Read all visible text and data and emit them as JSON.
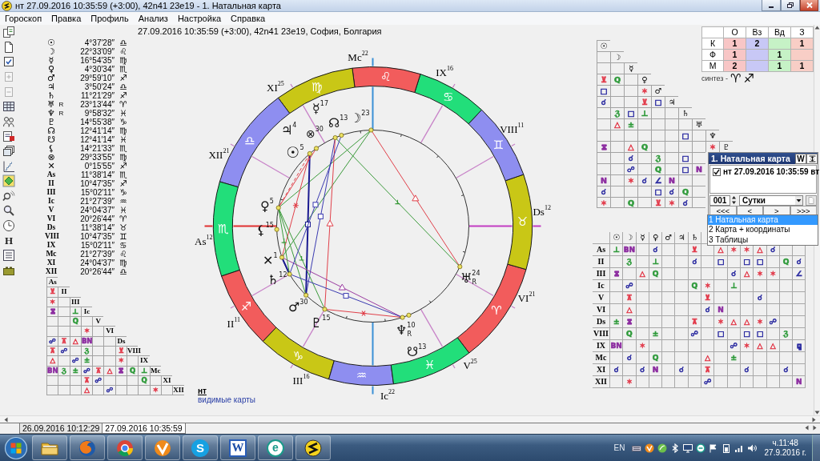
{
  "window": {
    "title": "нт 27.09.2016 10:35:59 (+3:00), 42n41 23e19 - 1. Натальная карта"
  },
  "menu": [
    "Гороскоп",
    "Правка",
    "Профиль",
    "Анализ",
    "Настройка",
    "Справка"
  ],
  "toolbar": [
    {
      "kind": "documents",
      "disabled": false
    },
    {
      "kind": "new-document",
      "disabled": false
    },
    {
      "kind": "checked-document",
      "disabled": false
    },
    {
      "kind": "add-document",
      "disabled": true
    },
    {
      "kind": "remove-document",
      "disabled": true
    },
    {
      "kind": "grid",
      "disabled": false
    },
    {
      "kind": "people",
      "disabled": false
    },
    {
      "kind": "flagged-document",
      "disabled": false
    },
    {
      "kind": "windows",
      "disabled": false
    },
    {
      "kind": "chart",
      "disabled": false
    },
    {
      "kind": "diamond",
      "disabled": false
    },
    {
      "kind": "signal-search",
      "disabled": false
    },
    {
      "kind": "search",
      "disabled": false
    },
    {
      "kind": "clock",
      "disabled": false
    },
    {
      "kind": "letter",
      "label": "H",
      "disabled": false
    },
    {
      "kind": "list",
      "disabled": false
    },
    {
      "kind": "battery",
      "disabled": false
    }
  ],
  "chart_header": "27.09.2016 10:35:59 (+3:00), 42n41 23e19, София, Болгария",
  "positions": [
    {
      "kind": "planet",
      "point": "☉",
      "value": "4°37′28″",
      "sign": "♎"
    },
    {
      "kind": "planet",
      "point": "☽",
      "value": "22°33′09″",
      "sign": "♌"
    },
    {
      "kind": "planet",
      "point": "☿",
      "value": "16°54′35″",
      "sign": "♍"
    },
    {
      "kind": "planet",
      "point": "♀",
      "value": "4°30′34″",
      "sign": "♏"
    },
    {
      "kind": "planet",
      "point": "♂",
      "value": "29°59′10″",
      "sign": "♐"
    },
    {
      "kind": "planet",
      "point": "♃",
      "value": "3°50′24″",
      "sign": "♎"
    },
    {
      "kind": "planet",
      "point": "♄",
      "value": "11°21′29″",
      "sign": "♐"
    },
    {
      "kind": "planet",
      "point": "♅",
      "retro": "R",
      "value": "23°13′44″",
      "sign": "♈"
    },
    {
      "kind": "planet",
      "point": "♆",
      "retro": "R",
      "value": "9°58′32″",
      "sign": "♓"
    },
    {
      "kind": "planet",
      "point": "♇",
      "value": "14°55′38″",
      "sign": "♑"
    },
    {
      "kind": "planet",
      "point": "☊",
      "value": "12°41′14″",
      "sign": "♍"
    },
    {
      "kind": "planet",
      "point": "☋",
      "value": "12°41′14″",
      "sign": "♓"
    },
    {
      "kind": "planet",
      "point": "⚸",
      "value": "14°21′33″",
      "sign": "♏"
    },
    {
      "kind": "planet",
      "point": "⊗",
      "value": "29°33′55″",
      "sign": "♍"
    },
    {
      "kind": "planet",
      "point": "✕",
      "value": "0°15′55″",
      "sign": "♐"
    },
    {
      "kind": "cusp",
      "point": "As",
      "value": "11°38′14″",
      "sign": "♏"
    },
    {
      "kind": "cusp",
      "point": "II",
      "value": "10°47′35″",
      "sign": "♐"
    },
    {
      "kind": "cusp",
      "point": "III",
      "value": "15°02′11″",
      "sign": "♑"
    },
    {
      "kind": "cusp",
      "point": "Ic",
      "value": "21°27′39″",
      "sign": "♒"
    },
    {
      "kind": "cusp",
      "point": "V",
      "value": "24°04′37″",
      "sign": "♓"
    },
    {
      "kind": "cusp",
      "point": "VI",
      "value": "20°26′44″",
      "sign": "♈"
    },
    {
      "kind": "cusp",
      "point": "Ds",
      "value": "11°38′14″",
      "sign": "♉"
    },
    {
      "kind": "cusp",
      "point": "VIII",
      "value": "10°47′35″",
      "sign": "♊"
    },
    {
      "kind": "cusp",
      "point": "IX",
      "value": "15°02′11″",
      "sign": "♋"
    },
    {
      "kind": "cusp",
      "point": "Mc",
      "value": "21°27′39″",
      "sign": "♌"
    },
    {
      "kind": "cusp",
      "point": "XI",
      "value": "24°04′37″",
      "sign": "♍"
    },
    {
      "kind": "cusp",
      "point": "XII",
      "value": "20°26′44″",
      "sign": "♎"
    }
  ],
  "house_aspects": {
    "rows": [
      {
        "label": "As"
      },
      {
        "label": "II",
        "cells": [
          {
            "symbol": "⊻",
            "color": "#e23a4a"
          }
        ]
      },
      {
        "label": "III",
        "cells": [
          {
            "symbol": "✶",
            "color": "#e23a4a"
          },
          null
        ]
      },
      {
        "label": "Ic",
        "cells": [
          {
            "symbol": "⧖",
            "color": "#8c2ca0"
          },
          null,
          {
            "symbol": "⊥",
            "color": "#2e9a3a"
          }
        ]
      },
      {
        "label": "V",
        "cells": [
          null,
          null,
          {
            "symbol": "Q",
            "color": "#2e9a3a"
          },
          null
        ]
      },
      {
        "label": "VI",
        "cells": [
          null,
          null,
          null,
          {
            "symbol": "✶",
            "color": "#e23a4a"
          },
          null
        ]
      },
      {
        "label": "Ds",
        "cells": [
          {
            "symbol": "☍",
            "color": "#2a2aa0"
          },
          {
            "symbol": "⊼",
            "color": "#e23a4a"
          },
          {
            "symbol": "△",
            "color": "#e23a4a"
          },
          {
            "symbol": "BN",
            "color": "#8c2ca0"
          },
          null,
          null
        ]
      },
      {
        "label": "VIII",
        "cells": [
          {
            "symbol": "⊼",
            "color": "#e23a4a"
          },
          {
            "symbol": "☍",
            "color": "#2a2aa0"
          },
          null,
          {
            "symbol": "ℨ",
            "color": "#2e9a3a"
          },
          null,
          null,
          {
            "symbol": "⊻",
            "color": "#e23a4a"
          }
        ]
      },
      {
        "label": "IX",
        "cells": [
          {
            "symbol": "△",
            "color": "#e23a4a"
          },
          null,
          {
            "symbol": "☍",
            "color": "#2a2aa0"
          },
          {
            "symbol": "±",
            "color": "#2e9a3a"
          },
          null,
          null,
          {
            "symbol": "✶",
            "color": "#e23a4a"
          },
          null
        ]
      },
      {
        "label": "Mc",
        "cells": [
          {
            "symbol": "BN",
            "color": "#8c2ca0"
          },
          {
            "symbol": "ℨ",
            "color": "#2e9a3a"
          },
          {
            "symbol": "±",
            "color": "#2e9a3a"
          },
          {
            "symbol": "☍",
            "color": "#2a2aa0"
          },
          {
            "symbol": "⊼",
            "color": "#e23a4a"
          },
          {
            "symbol": "△",
            "color": "#e23a4a"
          },
          {
            "symbol": "⧖",
            "color": "#8c2ca0"
          },
          {
            "symbol": "Q",
            "color": "#2e9a3a"
          },
          {
            "symbol": "⊥",
            "color": "#2e9a3a"
          }
        ]
      },
      {
        "label": "XI",
        "cells": [
          null,
          null,
          null,
          {
            "symbol": "⊼",
            "color": "#e23a4a"
          },
          {
            "symbol": "☍",
            "color": "#2a2aa0"
          },
          null,
          null,
          null,
          {
            "symbol": "Q",
            "color": "#2e9a3a"
          },
          null
        ]
      },
      {
        "label": "XII",
        "cells": [
          null,
          null,
          null,
          {
            "symbol": "△",
            "color": "#e23a4a"
          },
          null,
          {
            "symbol": "☍",
            "color": "#2a2aa0"
          },
          null,
          null,
          null,
          {
            "symbol": "✶",
            "color": "#e23a4a"
          },
          null
        ]
      }
    ]
  },
  "wheel": {
    "signs": [
      {
        "glyph": "♈",
        "color": "#f25c5c"
      },
      {
        "glyph": "♉",
        "color": "#c9c716"
      },
      {
        "glyph": "♊",
        "color": "#8e8ef0"
      },
      {
        "glyph": "♋",
        "color": "#22de7a"
      },
      {
        "glyph": "♌",
        "color": "#f25c5c"
      },
      {
        "glyph": "♍",
        "color": "#c9c716"
      },
      {
        "glyph": "♎",
        "color": "#8e8ef0"
      },
      {
        "glyph": "♏",
        "color": "#22de7a"
      },
      {
        "glyph": "♐",
        "color": "#f25c5c"
      },
      {
        "glyph": "♑",
        "color": "#c9c716"
      },
      {
        "glyph": "♒",
        "color": "#8e8ef0"
      },
      {
        "glyph": "♓",
        "color": "#22de7a"
      }
    ],
    "houses": [
      {
        "label": "As",
        "degree": "12",
        "color": "#e03030"
      },
      {
        "label": "II",
        "degree": "11",
        "color": "#c883c8"
      },
      {
        "label": "III",
        "degree": "16",
        "color": "#c883c8"
      },
      {
        "label": "Ic",
        "degree": "22",
        "color": "#3a90d6"
      },
      {
        "label": "V",
        "degree": "25",
        "color": "#c883c8"
      },
      {
        "label": "VI",
        "degree": "21",
        "color": "#c883c8"
      },
      {
        "label": "Ds",
        "degree": "12",
        "color": "#c23cc2"
      },
      {
        "label": "VIII",
        "degree": "11",
        "color": "#c883c8"
      },
      {
        "label": "IX",
        "degree": "16",
        "color": "#c883c8"
      },
      {
        "label": "Mc",
        "degree": "22",
        "color": "#3a90d6"
      },
      {
        "label": "XI",
        "degree": "25",
        "color": "#c883c8"
      },
      {
        "label": "XII",
        "degree": "21",
        "color": "#c883c8"
      }
    ],
    "planets": [
      {
        "glyph": "☉",
        "degree": "5"
      },
      {
        "glyph": "☽",
        "degree": "23"
      },
      {
        "glyph": "☿",
        "degree": "17"
      },
      {
        "glyph": "♀",
        "degree": "5"
      },
      {
        "glyph": "♂",
        "degree": "30"
      },
      {
        "glyph": "♃",
        "degree": "4"
      },
      {
        "glyph": "♄",
        "degree": "12"
      },
      {
        "glyph": "♅",
        "degree": "24",
        "retro": "R"
      },
      {
        "glyph": "♆",
        "degree": "10",
        "retro": "R"
      },
      {
        "glyph": "♇",
        "degree": "15"
      },
      {
        "glyph": "☊",
        "degree": "13"
      },
      {
        "glyph": "☋",
        "degree": "13"
      },
      {
        "glyph": "⚸",
        "degree": "15"
      },
      {
        "glyph": "⊗",
        "degree": "30"
      },
      {
        "glyph": "✕",
        "degree": "1"
      }
    ]
  },
  "caption": {
    "title": "нт",
    "link": "видимые карты"
  },
  "elements_table": {
    "columns": [
      {
        "label": "О",
        "color": "#f8c6c6"
      },
      {
        "label": "Вз",
        "color": "#c8c8f6"
      },
      {
        "label": "Вд",
        "color": "#c6f2c6"
      },
      {
        "label": "З",
        "color": "#f8cec6"
      }
    ],
    "rows": [
      {
        "label": "К",
        "cells": [
          "1",
          "2",
          null,
          "1"
        ]
      },
      {
        "label": "Ф",
        "cells": [
          "1",
          null,
          "1",
          null
        ]
      },
      {
        "label": "М",
        "cells": [
          "2",
          null,
          "1",
          "1"
        ]
      }
    ]
  },
  "synthesis": {
    "label": "синтез -",
    "signs": [
      "♈",
      "♐"
    ]
  },
  "planet_aspects": {
    "rows": [
      {
        "label": "☉"
      },
      {
        "label": "☽",
        "cells": [
          null
        ]
      },
      {
        "label": "☿",
        "cells": [
          null,
          null
        ]
      },
      {
        "label": "♀",
        "cells": [
          {
            "symbol": "⊻",
            "color": "#e23a4a"
          },
          {
            "symbol": "Q",
            "color": "#2e9a3a"
          },
          null
        ]
      },
      {
        "label": "♂",
        "cells": [
          {
            "symbol": "□",
            "color": "#2a2aa0"
          },
          null,
          null,
          {
            "symbol": "✶",
            "color": "#e23a4a"
          }
        ]
      },
      {
        "label": "♃",
        "cells": [
          {
            "symbol": "☌",
            "color": "#2a2aa0"
          },
          null,
          null,
          {
            "symbol": "⊻",
            "color": "#e23a4a"
          },
          {
            "symbol": "□",
            "color": "#2a2aa0"
          }
        ]
      },
      {
        "label": "♄",
        "cells": [
          null,
          {
            "symbol": "ℨ",
            "color": "#2e9a3a"
          },
          {
            "symbol": "□",
            "color": "#2a2aa0"
          },
          {
            "symbol": "⊥",
            "color": "#2e9a3a"
          },
          null,
          null
        ]
      },
      {
        "label": "♅",
        "cells": [
          null,
          {
            "symbol": "△",
            "color": "#e23a4a"
          },
          {
            "symbol": "±",
            "color": "#2e9a3a"
          },
          null,
          null,
          null,
          null
        ]
      },
      {
        "label": "♆",
        "cells": [
          null,
          null,
          null,
          null,
          null,
          null,
          {
            "symbol": "□",
            "color": "#2a2aa0"
          },
          null
        ]
      },
      {
        "label": "♇",
        "cells": [
          {
            "symbol": "⧖",
            "color": "#8c2ca0"
          },
          null,
          {
            "symbol": "△",
            "color": "#e23a4a"
          },
          {
            "symbol": "Q",
            "color": "#2e9a3a"
          },
          null,
          null,
          null,
          null,
          {
            "symbol": "✶",
            "color": "#e23a4a"
          }
        ]
      },
      {
        "cells": [
          null,
          null,
          {
            "symbol": "☌",
            "color": "#2a2aa0"
          },
          null,
          {
            "symbol": "ℨ",
            "color": "#2e9a3a"
          },
          null,
          {
            "symbol": "□",
            "color": "#2a2aa0"
          },
          null
        ]
      },
      {
        "cells": [
          null,
          null,
          {
            "symbol": "☍",
            "color": "#2a2aa0"
          },
          null,
          {
            "symbol": "Q",
            "color": "#2e9a3a"
          },
          null,
          {
            "symbol": "□",
            "color": "#2a2aa0"
          },
          {
            "symbol": "N",
            "color": "#8c2ca0"
          }
        ]
      },
      {
        "cells": [
          {
            "symbol": "N",
            "color": "#8c2ca0"
          },
          null,
          {
            "symbol": "✶",
            "color": "#e23a4a"
          },
          {
            "symbol": "☌",
            "color": "#2a2aa0"
          },
          {
            "symbol": "∠",
            "color": "#2a2aa0"
          },
          {
            "symbol": "N",
            "color": "#8c2ca0"
          },
          null,
          null
        ]
      },
      {
        "cells": [
          {
            "symbol": "☌",
            "color": "#2a2aa0"
          },
          null,
          null,
          null,
          {
            "symbol": "□",
            "color": "#2a2aa0"
          },
          {
            "symbol": "☌",
            "color": "#2a2aa0"
          },
          {
            "symbol": "Q",
            "color": "#2e9a3a"
          },
          null
        ]
      },
      {
        "cells": [
          {
            "symbol": "✶",
            "color": "#e23a4a"
          },
          null,
          {
            "symbol": "Q",
            "color": "#2e9a3a"
          },
          null,
          {
            "symbol": "⊻",
            "color": "#e23a4a"
          },
          {
            "symbol": "✶",
            "color": "#e23a4a"
          },
          {
            "symbol": "☌",
            "color": "#2a2aa0"
          },
          null
        ]
      }
    ]
  },
  "house_planet_aspects": {
    "columns": [
      "☉",
      "☽",
      "☿",
      "♀",
      "♂",
      "♃",
      "♄"
    ],
    "rows": [
      {
        "label": "As",
        "cells": [
          {
            "symbol": "⊥",
            "color": "#2e9a3a"
          },
          {
            "symbol": "BN",
            "color": "#8c2ca0"
          },
          null,
          {
            "symbol": "☌",
            "color": "#2a2aa0"
          },
          null,
          null,
          {
            "symbol": "⊻",
            "color": "#e23a4a"
          },
          null,
          {
            "symbol": "△",
            "color": "#e23a4a"
          },
          {
            "symbol": "✶",
            "color": "#e23a4a"
          },
          {
            "symbol": "✶",
            "color": "#e23a4a"
          },
          {
            "symbol": "△",
            "color": "#e23a4a"
          },
          {
            "symbol": "☌",
            "color": "#2a2aa0"
          }
        ]
      },
      {
        "label": "II",
        "cells": [
          null,
          {
            "symbol": "ℨ",
            "color": "#2e9a3a"
          },
          null,
          {
            "symbol": "⊥",
            "color": "#2e9a3a"
          },
          null,
          null,
          {
            "symbol": "☌",
            "color": "#2a2aa0"
          },
          null,
          {
            "symbol": "□",
            "color": "#2a2aa0"
          },
          null,
          {
            "symbol": "□",
            "color": "#2a2aa0"
          },
          {
            "symbol": "□",
            "color": "#2a2aa0"
          },
          null,
          {
            "symbol": "Q",
            "color": "#2e9a3a"
          },
          {
            "symbol": "☌",
            "color": "#2a2aa0"
          }
        ]
      },
      {
        "label": "III",
        "cells": [
          {
            "symbol": "⧖",
            "color": "#8c2ca0"
          },
          null,
          {
            "symbol": "△",
            "color": "#e23a4a"
          },
          {
            "symbol": "Q",
            "color": "#2e9a3a"
          },
          null,
          null,
          null,
          null,
          null,
          {
            "symbol": "☌",
            "color": "#2a2aa0"
          },
          {
            "symbol": "△",
            "color": "#e23a4a"
          },
          {
            "symbol": "✶",
            "color": "#e23a4a"
          },
          {
            "symbol": "✶",
            "color": "#e23a4a"
          },
          null,
          {
            "symbol": "∠",
            "color": "#2a2aa0"
          }
        ]
      },
      {
        "label": "Ic",
        "cells": [
          null,
          {
            "symbol": "☍",
            "color": "#2a2aa0"
          },
          null,
          null,
          null,
          null,
          {
            "symbol": "Q",
            "color": "#2e9a3a"
          },
          {
            "symbol": "✶",
            "color": "#e23a4a"
          },
          null,
          {
            "symbol": "⊥",
            "color": "#2e9a3a"
          }
        ]
      },
      {
        "label": "V",
        "cells": [
          null,
          {
            "symbol": "⊼",
            "color": "#e23a4a"
          },
          null,
          null,
          null,
          null,
          null,
          {
            "symbol": "⊻",
            "color": "#e23a4a"
          },
          null,
          null,
          null,
          {
            "symbol": "☌",
            "color": "#2a2aa0"
          }
        ]
      },
      {
        "label": "VI",
        "cells": [
          null,
          {
            "symbol": "△",
            "color": "#e23a4a"
          },
          null,
          null,
          null,
          null,
          null,
          {
            "symbol": "☌",
            "color": "#2a2aa0"
          },
          {
            "symbol": "N",
            "color": "#8c2ca0"
          }
        ]
      },
      {
        "label": "Ds",
        "cells": [
          {
            "symbol": "±",
            "color": "#2e9a3a"
          },
          {
            "symbol": "⧖",
            "color": "#8c2ca0"
          },
          null,
          null,
          null,
          null,
          {
            "symbol": "⊼",
            "color": "#e23a4a"
          },
          null,
          {
            "symbol": "✶",
            "color": "#e23a4a"
          },
          {
            "symbol": "△",
            "color": "#e23a4a"
          },
          {
            "symbol": "△",
            "color": "#e23a4a"
          },
          {
            "symbol": "✶",
            "color": "#e23a4a"
          },
          {
            "symbol": "☍",
            "color": "#2a2aa0"
          }
        ]
      },
      {
        "label": "VIII",
        "cells": [
          null,
          {
            "symbol": "Q",
            "color": "#2e9a3a"
          },
          null,
          {
            "symbol": "±",
            "color": "#2e9a3a"
          },
          null,
          null,
          {
            "symbol": "☍",
            "color": "#2a2aa0"
          },
          null,
          {
            "symbol": "□",
            "color": "#2a2aa0"
          },
          null,
          {
            "symbol": "□",
            "color": "#2a2aa0"
          },
          {
            "symbol": "□",
            "color": "#2a2aa0"
          },
          null,
          {
            "symbol": "ℨ",
            "color": "#2e9a3a"
          }
        ]
      },
      {
        "label": "IX",
        "cells": [
          {
            "symbol": "BN",
            "color": "#8c2ca0"
          },
          null,
          {
            "symbol": "✶",
            "color": "#e23a4a"
          },
          null,
          null,
          null,
          null,
          null,
          null,
          {
            "symbol": "☍",
            "color": "#2a2aa0"
          },
          {
            "symbol": "✶",
            "color": "#e23a4a"
          },
          {
            "symbol": "△",
            "color": "#e23a4a"
          },
          {
            "symbol": "△",
            "color": "#e23a4a"
          },
          null,
          {
            "symbol": "⚼",
            "color": "#2a2aa0"
          }
        ]
      },
      {
        "label": "Mc",
        "cells": [
          null,
          {
            "symbol": "☌",
            "color": "#2a2aa0"
          },
          null,
          {
            "symbol": "Q",
            "color": "#2e9a3a"
          },
          null,
          null,
          null,
          {
            "symbol": "△",
            "color": "#e23a4a"
          },
          null,
          {
            "symbol": "±",
            "color": "#2e9a3a"
          }
        ]
      },
      {
        "label": "XI",
        "cells": [
          {
            "symbol": "☌",
            "color": "#2a2aa0"
          },
          null,
          {
            "symbol": "☌",
            "color": "#2a2aa0"
          },
          {
            "symbol": "N",
            "color": "#8c2ca0"
          },
          null,
          {
            "symbol": "☌",
            "color": "#2a2aa0"
          },
          null,
          {
            "symbol": "⊼",
            "color": "#e23a4a"
          },
          null,
          null,
          {
            "symbol": "☌",
            "color": "#2a2aa0"
          },
          null,
          null,
          {
            "symbol": "☌",
            "color": "#2a2aa0"
          }
        ]
      },
      {
        "label": "XII",
        "cells": [
          null,
          {
            "symbol": "✶",
            "color": "#e23a4a"
          },
          null,
          null,
          null,
          null,
          null,
          {
            "symbol": "☍",
            "color": "#2a2aa0"
          },
          null,
          null,
          null,
          null,
          null,
          null,
          {
            "symbol": "N",
            "color": "#8c2ca0"
          }
        ]
      }
    ]
  },
  "chart_window": {
    "title": "1. Натальная карта",
    "mode_button": "W",
    "entries": [
      {
        "label": "нт 27.09.2016 10:35:59 вт",
        "checked": true
      }
    ],
    "step": "001",
    "period": "Сутки",
    "side_button_disabled": true,
    "nav_buttons": [
      "<<<",
      "<",
      ">",
      ">>>"
    ]
  },
  "view_list": {
    "items": [
      {
        "label": "1 Натальная карта",
        "selected": true
      },
      {
        "label": "2 Карта + координаты",
        "selected": false
      },
      {
        "label": "3 Таблицы",
        "selected": false
      }
    ]
  },
  "tabs": [
    {
      "label": "26.09.2016 10:12:29",
      "selected": false
    },
    {
      "label": "27.09.2016 10:35:59",
      "selected": true
    }
  ],
  "taskbar": {
    "apps": [
      {
        "kind": "folder"
      },
      {
        "kind": "globe"
      },
      {
        "kind": "ring"
      },
      {
        "kind": "tick"
      },
      {
        "kind": "bubble",
        "letter": "S"
      },
      {
        "kind": "page",
        "letter": "W"
      },
      {
        "kind": "orb",
        "letter": "e"
      },
      {
        "kind": "zigzag"
      }
    ],
    "language": "EN",
    "tray": [
      {
        "kind": "keyboard"
      },
      {
        "kind": "tick"
      },
      {
        "kind": "swoosh"
      },
      {
        "kind": "bluetooth"
      },
      {
        "kind": "monitor"
      },
      {
        "kind": "minus-circle"
      },
      {
        "kind": "flag"
      },
      {
        "kind": "battery"
      },
      {
        "kind": "signal"
      },
      {
        "kind": "speaker"
      }
    ],
    "time": "ч.11:48",
    "date": "27.9.2016 г."
  }
}
